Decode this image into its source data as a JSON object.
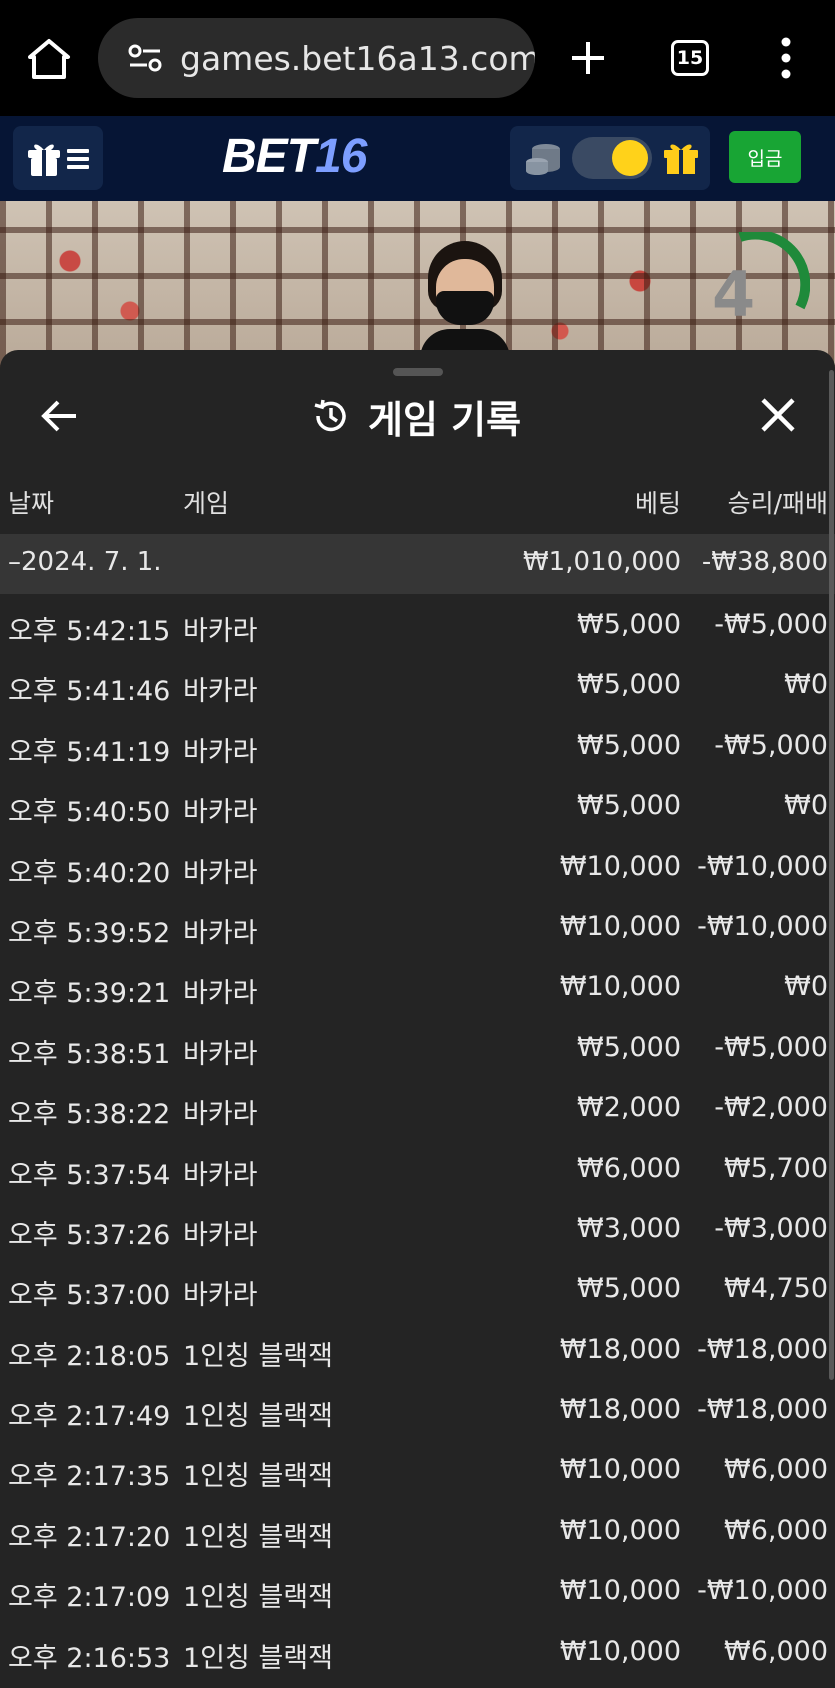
{
  "browser": {
    "url": "games.bet16a13.com/l",
    "tab_count": "15"
  },
  "header": {
    "logo_part1": "BET",
    "logo_part2": "16",
    "deposit_label": "입금",
    "colors": {
      "bg": "#061535",
      "deposit": "#18a534",
      "logo_accent": "#7d9eff",
      "toggle_knob": "#ffd21a"
    }
  },
  "video": {
    "timer": "4"
  },
  "history": {
    "title": "게임 기록",
    "columns": {
      "date": "날짜",
      "game": "게임",
      "bet": "베팅",
      "result": "승리/패배"
    },
    "date_group": {
      "date": "–2024. 7. 1.",
      "total_bet": "₩1,010,000",
      "total_result": "-₩38,800"
    },
    "rows": [
      {
        "time": "오후 5:42:15",
        "game": "바카라",
        "bet": "₩5,000",
        "result": "-₩5,000"
      },
      {
        "time": "오후 5:41:46",
        "game": "바카라",
        "bet": "₩5,000",
        "result": "₩0"
      },
      {
        "time": "오후 5:41:19",
        "game": "바카라",
        "bet": "₩5,000",
        "result": "-₩5,000"
      },
      {
        "time": "오후 5:40:50",
        "game": "바카라",
        "bet": "₩5,000",
        "result": "₩0"
      },
      {
        "time": "오후 5:40:20",
        "game": "바카라",
        "bet": "₩10,000",
        "result": "-₩10,000"
      },
      {
        "time": "오후 5:39:52",
        "game": "바카라",
        "bet": "₩10,000",
        "result": "-₩10,000"
      },
      {
        "time": "오후 5:39:21",
        "game": "바카라",
        "bet": "₩10,000",
        "result": "₩0"
      },
      {
        "time": "오후 5:38:51",
        "game": "바카라",
        "bet": "₩5,000",
        "result": "-₩5,000"
      },
      {
        "time": "오후 5:38:22",
        "game": "바카라",
        "bet": "₩2,000",
        "result": "-₩2,000"
      },
      {
        "time": "오후 5:37:54",
        "game": "바카라",
        "bet": "₩6,000",
        "result": "₩5,700"
      },
      {
        "time": "오후 5:37:26",
        "game": "바카라",
        "bet": "₩3,000",
        "result": "-₩3,000"
      },
      {
        "time": "오후 5:37:00",
        "game": "바카라",
        "bet": "₩5,000",
        "result": "₩4,750"
      },
      {
        "time": "오후 2:18:05",
        "game": "1인칭 블랙잭",
        "bet": "₩18,000",
        "result": "-₩18,000"
      },
      {
        "time": "오후 2:17:49",
        "game": "1인칭 블랙잭",
        "bet": "₩18,000",
        "result": "-₩18,000"
      },
      {
        "time": "오후 2:17:35",
        "game": "1인칭 블랙잭",
        "bet": "₩10,000",
        "result": "₩6,000"
      },
      {
        "time": "오후 2:17:20",
        "game": "1인칭 블랙잭",
        "bet": "₩10,000",
        "result": "₩6,000"
      },
      {
        "time": "오후 2:17:09",
        "game": "1인칭 블랙잭",
        "bet": "₩10,000",
        "result": "-₩10,000"
      },
      {
        "time": "오후 2:16:53",
        "game": "1인칭 블랙잭",
        "bet": "₩10,000",
        "result": "₩6,000"
      }
    ]
  }
}
